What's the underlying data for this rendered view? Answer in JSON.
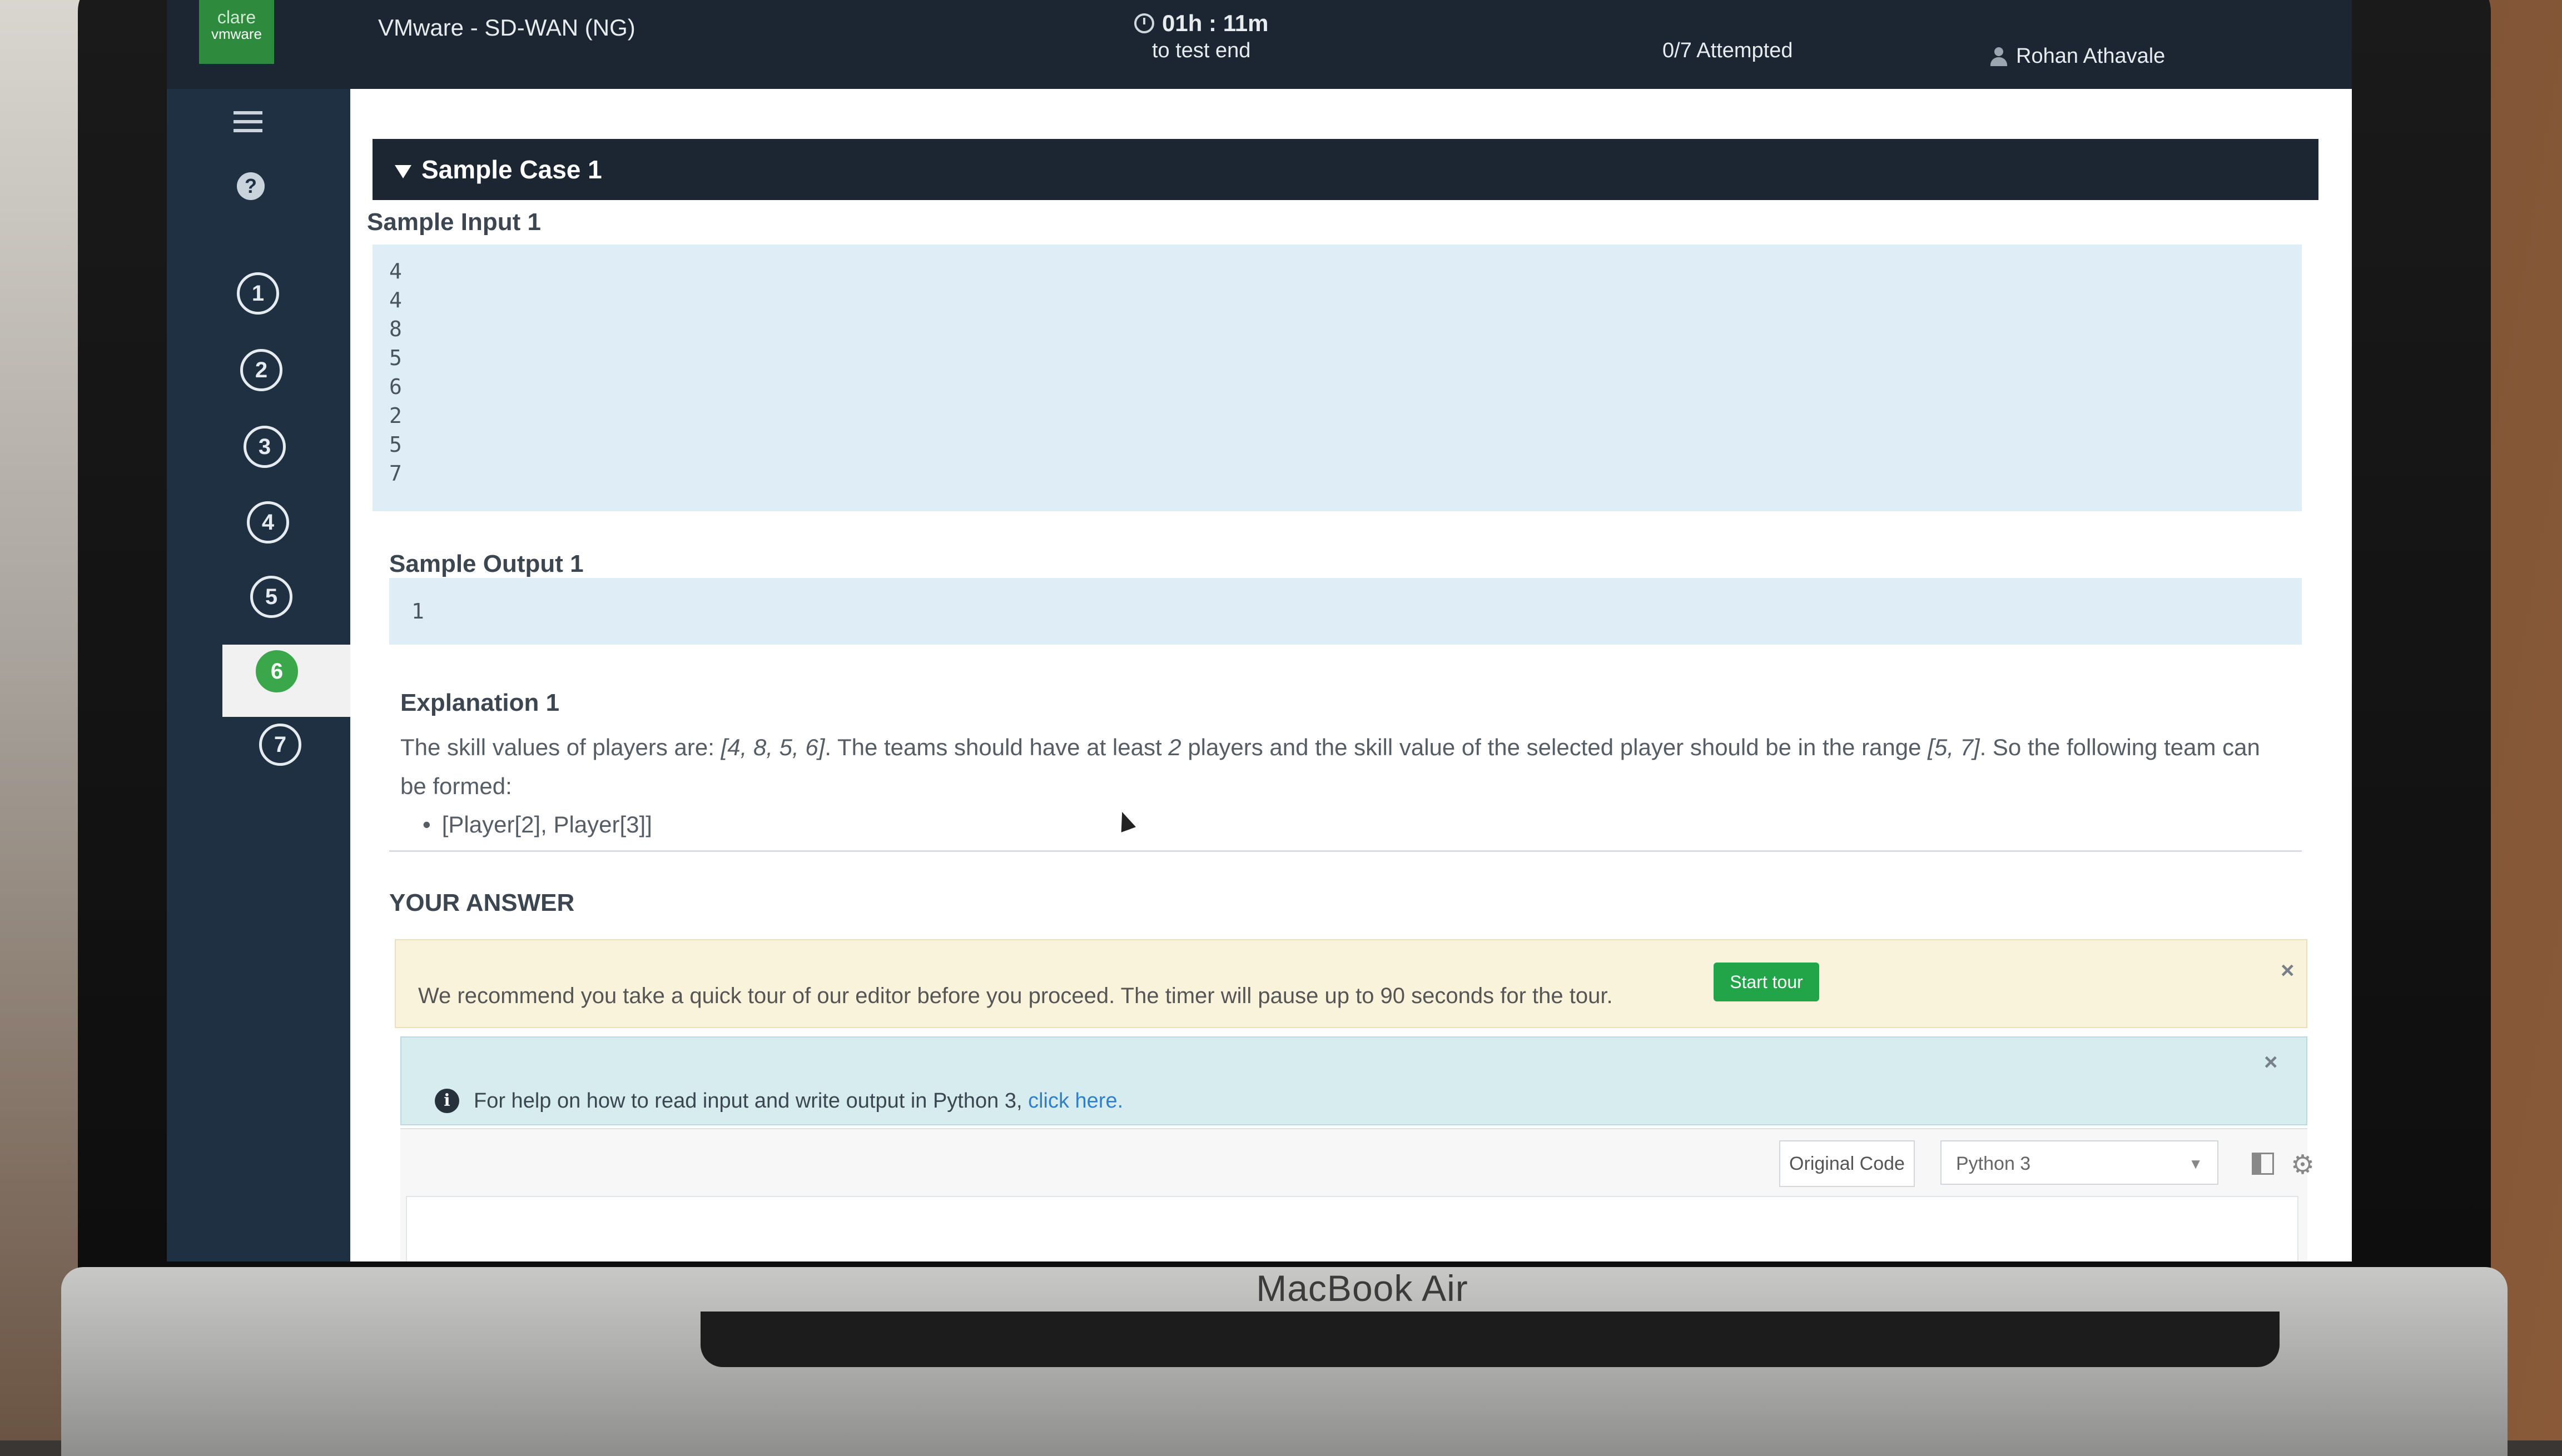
{
  "header": {
    "logo_top": "clare",
    "logo_bottom": "vmware",
    "app_title": "VMware - SD-WAN (NG)",
    "timer": "01h : 11m",
    "timer_caption": "to test end",
    "attempted": "0/7 Attempted",
    "user": "Rohan Athavale"
  },
  "rail": {
    "questions": [
      "1",
      "2",
      "3",
      "4",
      "5",
      "6",
      "7"
    ],
    "active_question": "6"
  },
  "sample_case": {
    "title": "Sample Case 1",
    "input_label": "Sample Input 1",
    "input_lines": [
      "4",
      "4",
      "8",
      "5",
      "6",
      "2",
      "5",
      "7"
    ],
    "output_label": "Sample Output 1",
    "output_value": "1",
    "explanation_label": "Explanation 1",
    "explanation_before": "The skill values of players are: ",
    "explanation_values": "[4, 8, 5, 6]",
    "explanation_mid": ". The teams should have at least ",
    "explanation_num": "2",
    "explanation_mid2": " players and the skill value of the selected player should be in the range ",
    "explanation_range": "[5, 7]",
    "explanation_after": ". So the following team can be formed:",
    "bullet": "[Player[2], Player[3]]"
  },
  "answer": {
    "heading": "YOUR ANSWER",
    "tour_text": "We recommend you take a quick tour of our editor before you proceed. The timer will pause up to 90 seconds for the tour.",
    "tour_button": "Start tour",
    "help_text": "For help on how to read input and write output in Python 3, ",
    "help_link": "click here.",
    "original_code": "Original Code",
    "language": "Python 3"
  },
  "device": {
    "brand": "MacBook Air"
  },
  "colors": {
    "accent_green": "#21a548",
    "header_dark": "#1b2632",
    "rail": "#1e3042",
    "code_bg": "#dfeef6",
    "link": "#2f7fd1"
  }
}
